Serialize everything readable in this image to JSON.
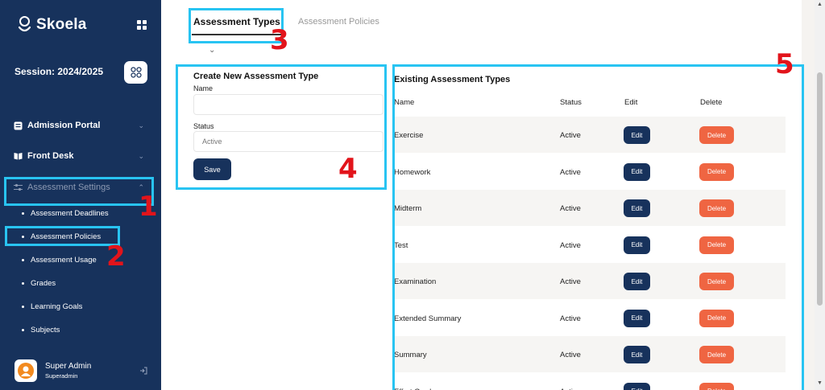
{
  "app": {
    "brand": "Skoela"
  },
  "sidebar": {
    "session": "Session: 2024/2025",
    "nav": [
      {
        "label": "Admission Portal"
      },
      {
        "label": "Front Desk"
      },
      {
        "label": "Assessment Settings"
      }
    ],
    "sub_items": [
      {
        "label": "Assessment Deadlines"
      },
      {
        "label": "Assessment Policies"
      },
      {
        "label": "Assessment Usage"
      },
      {
        "label": "Grades"
      },
      {
        "label": "Learning Goals"
      },
      {
        "label": "Subjects"
      }
    ],
    "user": {
      "name": "Super Admin",
      "role": "Superadmin"
    }
  },
  "tabs": [
    {
      "label": "Assessment Types"
    },
    {
      "label": "Assessment Policies"
    }
  ],
  "form": {
    "title": "Create New Assessment Type",
    "name_label": "Name",
    "name_value": "",
    "status_label": "Status",
    "status_value": "Active",
    "save_label": "Save"
  },
  "table": {
    "title": "Existing Assessment Types",
    "headers": {
      "name": "Name",
      "status": "Status",
      "edit": "Edit",
      "delete": "Delete"
    },
    "edit_label": "Edit",
    "delete_label": "Delete",
    "rows": [
      {
        "name": "Exercise",
        "status": "Active"
      },
      {
        "name": "Homework",
        "status": "Active"
      },
      {
        "name": "Midterm",
        "status": "Active"
      },
      {
        "name": "Test",
        "status": "Active"
      },
      {
        "name": "Examination",
        "status": "Active"
      },
      {
        "name": "Extended Summary",
        "status": "Active"
      },
      {
        "name": "Summary",
        "status": "Active"
      },
      {
        "name": "Effort Grade",
        "status": "Active"
      }
    ]
  },
  "annotations": [
    "1",
    "2",
    "3",
    "4",
    "5"
  ],
  "colors": {
    "sidebar": "#17325c",
    "primary": "#17325c",
    "danger": "#ef6542",
    "highlight": "#28c4f2",
    "annotation_text": "#e2141b"
  }
}
